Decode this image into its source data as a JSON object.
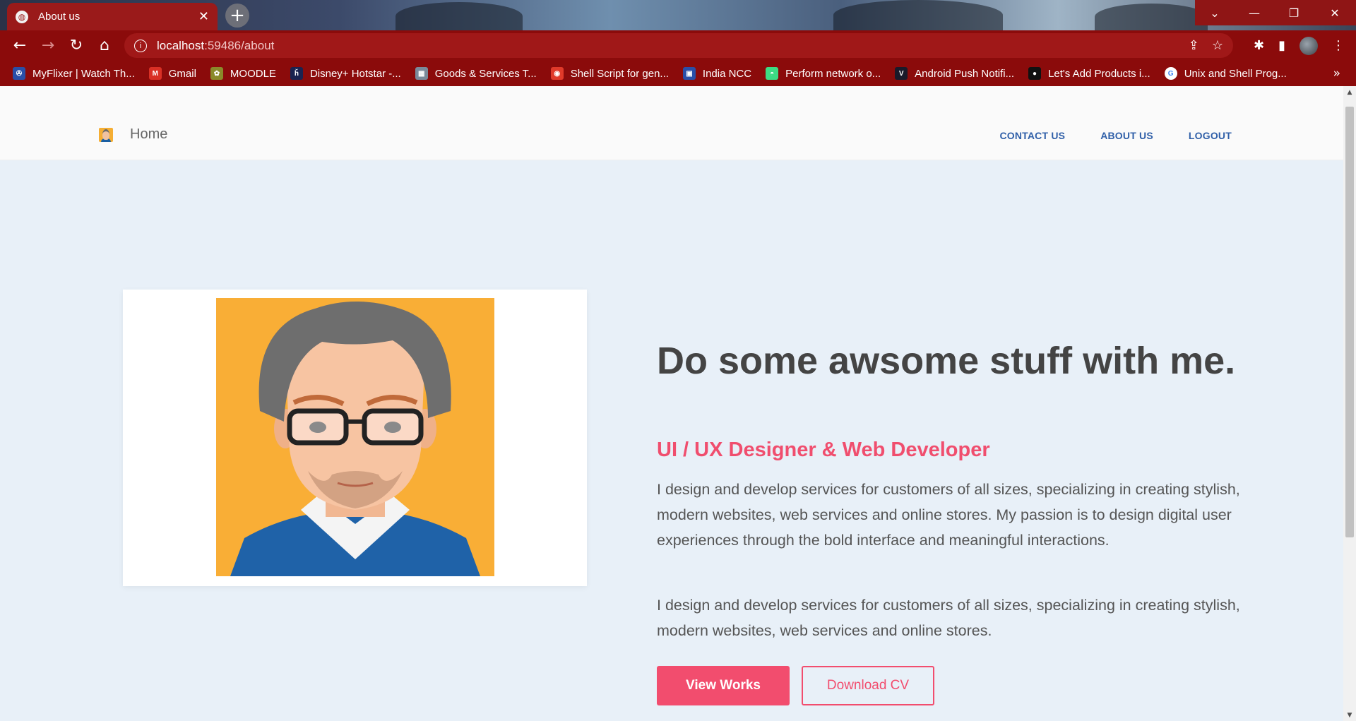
{
  "browser": {
    "tab_title": "About us",
    "url_host": "localhost",
    "url_rest": ":59486/about",
    "bookmarks": [
      {
        "label": "MyFlixer | Watch Th...",
        "icon": "film-icon",
        "color": "#2a4fa8"
      },
      {
        "label": "Gmail",
        "icon": "gmail-icon",
        "color": "#d93025"
      },
      {
        "label": "MOODLE",
        "icon": "moodle-icon",
        "color": "#8a8a2a"
      },
      {
        "label": "Disney+ Hotstar -...",
        "icon": "hotstar-icon",
        "color": "#1a2350"
      },
      {
        "label": "Goods & Services T...",
        "icon": "gst-icon",
        "color": "#7a8a9a"
      },
      {
        "label": "Shell Script for gen...",
        "icon": "record-icon",
        "color": "#e03a2a"
      },
      {
        "label": "India NCC",
        "icon": "ncc-icon",
        "color": "#2a4fa8"
      },
      {
        "label": "Perform network o...",
        "icon": "android-icon",
        "color": "#3ddc84"
      },
      {
        "label": "Android Push Notifi...",
        "icon": "v-icon",
        "color": "#1a1a2a"
      },
      {
        "label": "Let's Add Products i...",
        "icon": "medium-icon",
        "color": "#111111"
      },
      {
        "label": "Unix and Shell Prog...",
        "icon": "google-icon",
        "color": "#ffffff"
      }
    ],
    "bookmarks_more": "»"
  },
  "nav": {
    "home_label": "Home",
    "links": [
      "CONTACT US",
      "ABOUT US",
      "LOGOUT"
    ]
  },
  "hero": {
    "headline": "Do some awsome stuff with me.",
    "subheadline": "UI / UX Designer & Web Developer",
    "paragraph1": "I design and develop services for customers of all sizes, specializing in creating stylish, modern websites, web services and online stores. My passion is to design digital user experiences through the bold interface and meaningful interactions.",
    "paragraph2": "I design and develop services for customers of all sizes, specializing in creating stylish, modern websites, web services and online stores.",
    "primary_button": "View Works",
    "secondary_button": "Download CV"
  },
  "colors": {
    "chrome_red": "#8b0b0b",
    "accent_pink": "#f24d6e",
    "nav_link_blue": "#2f5fa8",
    "hero_bg": "#e8f0f8",
    "avatar_bg": "#f9ae36"
  }
}
